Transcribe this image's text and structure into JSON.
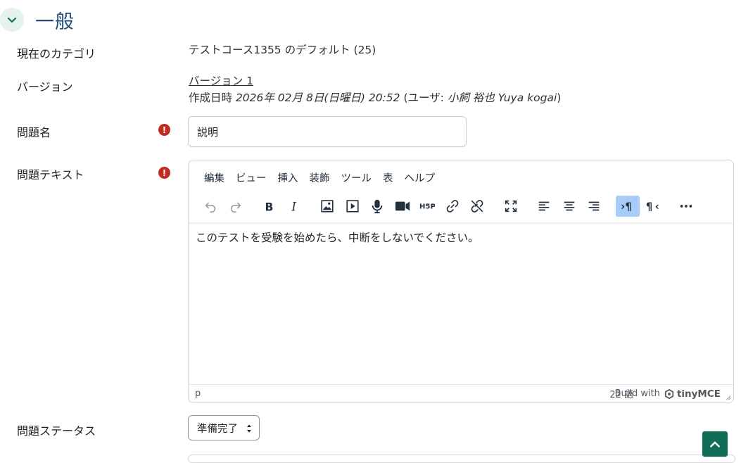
{
  "section": {
    "title": "一般"
  },
  "fields": {
    "category_label": "現在のカテゴリ",
    "category_value": "テストコース1355 のデフォルト (25)",
    "version_label": "バージョン",
    "version_link": "バージョン 1",
    "created_prefix": "作成日時 ",
    "created_date": "2026年 02月 8日(日曜日) 20:52",
    "created_user_prefix": " (ユーザ: ",
    "created_user": "小飼 裕也 Yuya kogai",
    "created_suffix": ")",
    "name_label": "問題名",
    "name_value": "説明",
    "text_label": "問題テキスト",
    "status_label": "問題ステータス",
    "status_value": "準備完了"
  },
  "required_icon": "!",
  "editor": {
    "menus": [
      "編集",
      "ビュー",
      "挿入",
      "装飾",
      "ツール",
      "表",
      "ヘルプ"
    ],
    "content": "このテストを受験を始めたら、中断をしないでください。",
    "path": "p",
    "word_count": "22 語",
    "branding": "Build with",
    "brand_name": "tinyMCE",
    "toolbar_icons": [
      "undo-icon",
      "redo-icon",
      "bold-icon",
      "italic-icon",
      "image-icon",
      "media-icon",
      "microphone-icon",
      "video-camera-icon",
      "h5p-icon",
      "link-icon",
      "unlink-icon",
      "fullscreen-icon",
      "align-left-icon",
      "align-center-icon",
      "align-right-icon",
      "ltr-icon",
      "rtl-icon",
      "more-icon"
    ],
    "active_button": "ltr-icon"
  },
  "colors": {
    "accent": "#0f6e55",
    "title": "#1f4a7a",
    "required": "#c22b24",
    "active_tool": "#a6ccf7"
  }
}
